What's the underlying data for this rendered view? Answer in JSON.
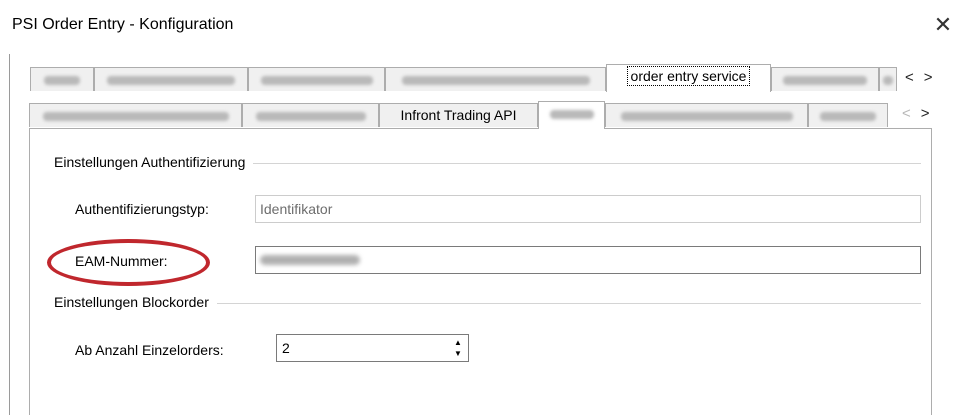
{
  "window": {
    "title": "PSI Order Entry - Konfiguration",
    "close_glyph": "✕"
  },
  "tabs_row1": {
    "active_label": "order entry service",
    "scroll_left": "<",
    "scroll_right": ">"
  },
  "tabs_row2": {
    "labeled_tab": "Infront Trading API",
    "scroll_left": "<",
    "scroll_right": ">"
  },
  "auth_group": {
    "title": "Einstellungen Authentifizierung",
    "type_label": "Authentifizierungstyp:",
    "type_value": "Identifikator",
    "eam_label": "EAM-Nummer:"
  },
  "block_group": {
    "title": "Einstellungen Blockorder",
    "count_label": "Ab Anzahl Einzelorders:",
    "count_value": "2",
    "spin_up": "▲",
    "spin_down": "▼"
  },
  "colors": {
    "highlight_ellipse": "#c0272d",
    "readonly_text": "#6d6d6d"
  }
}
